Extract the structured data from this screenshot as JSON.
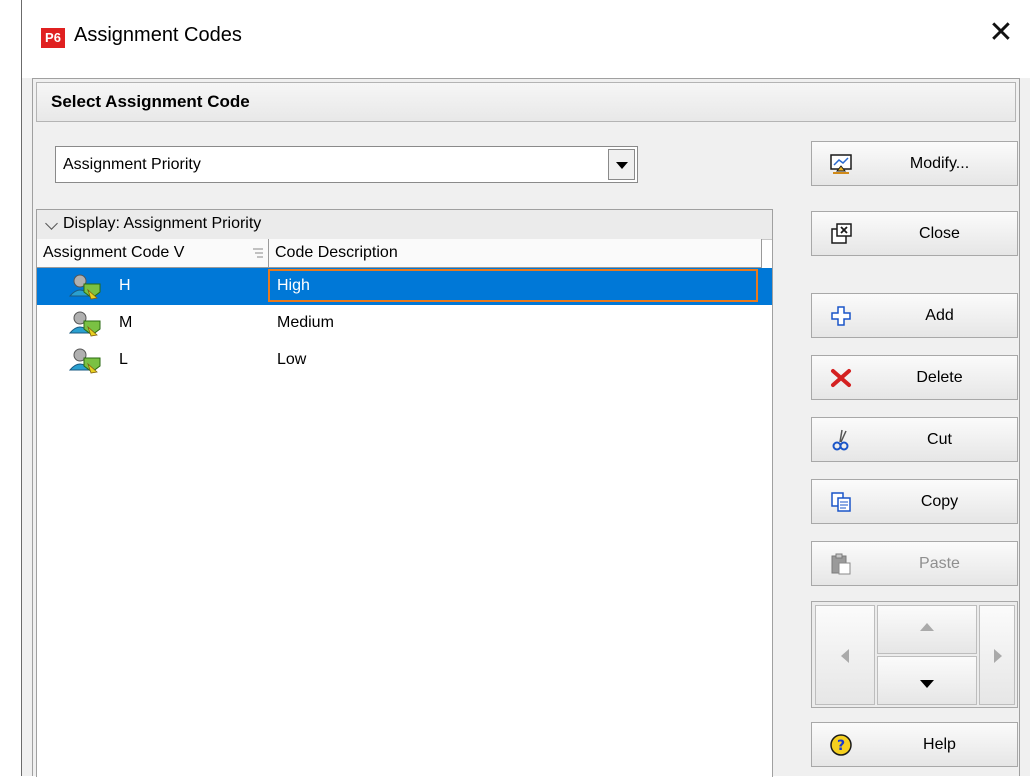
{
  "window": {
    "app_badge": "P6",
    "title": "Assignment Codes"
  },
  "section": {
    "title": "Select Assignment Code"
  },
  "code_select": {
    "value": "Assignment Priority"
  },
  "grid": {
    "group_label": "Display: Assignment Priority",
    "columns": [
      "Assignment Code V",
      "Code Description"
    ],
    "rows": [
      {
        "code": "H",
        "description": "High",
        "selected": true
      },
      {
        "code": "M",
        "description": "Medium",
        "selected": false
      },
      {
        "code": "L",
        "description": "Low",
        "selected": false
      }
    ]
  },
  "buttons": {
    "modify": "Modify...",
    "close": "Close",
    "add": "Add",
    "delete": "Delete",
    "cut": "Cut",
    "copy": "Copy",
    "paste": "Paste",
    "help": "Help"
  },
  "colors": {
    "selection": "#0078d7",
    "focus_border": "#e87a1e",
    "logo": "#e02020"
  }
}
